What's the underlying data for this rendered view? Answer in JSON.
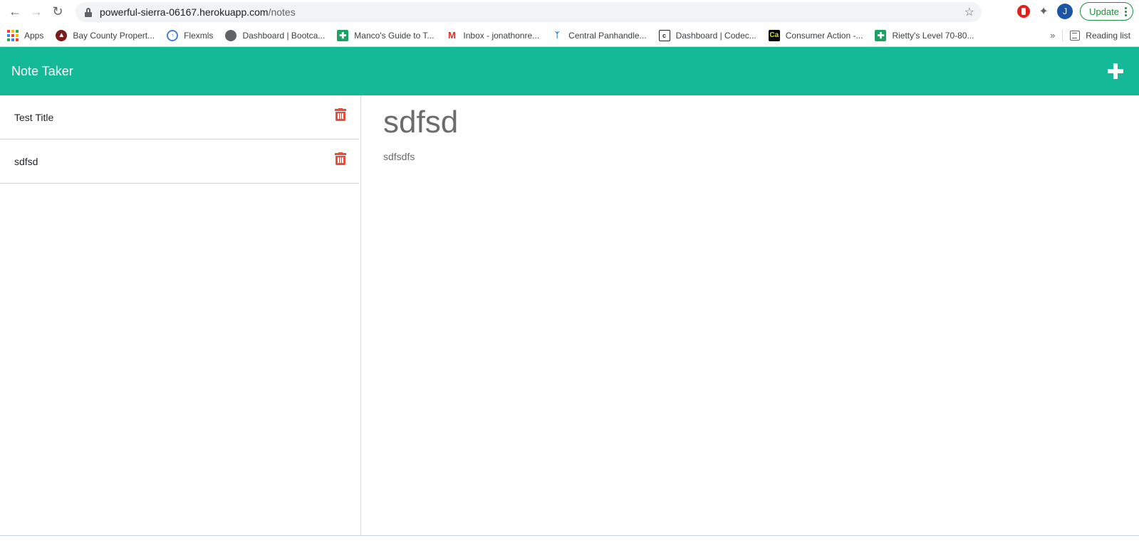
{
  "browser": {
    "url_host": "powerful-sierra-06167.herokuapp.com",
    "url_path": "/notes",
    "update_label": "Update",
    "profile_initial": "J",
    "bookmarks": [
      {
        "label": "Apps",
        "icon": "apps-grid-icon"
      },
      {
        "label": "Bay County Propert...",
        "icon": "bay-county-icon"
      },
      {
        "label": "Flexmls",
        "icon": "flexmls-icon"
      },
      {
        "label": "Dashboard | Bootca...",
        "icon": "globe-icon"
      },
      {
        "label": "Manco's Guide to T...",
        "icon": "sheets-icon"
      },
      {
        "label": "Inbox - jonathonre...",
        "icon": "gmail-icon"
      },
      {
        "label": "Central Panhandle...",
        "icon": "people-icon"
      },
      {
        "label": "Dashboard | Codec...",
        "icon": "codecademy-icon"
      },
      {
        "label": "Consumer Action -...",
        "icon": "ca-icon"
      },
      {
        "label": "Rietty's Level 70-80...",
        "icon": "sheets-icon"
      }
    ],
    "overflow_label": "»",
    "reading_list_label": "Reading list"
  },
  "app": {
    "title": "Note Taker",
    "accent_color": "#14b997",
    "delete_color": "#e74c3c",
    "notes": [
      {
        "title": "Test Title"
      },
      {
        "title": "sdfsd"
      }
    ],
    "active_note": {
      "title": "sdfsd",
      "text": "sdfsdfs"
    }
  }
}
